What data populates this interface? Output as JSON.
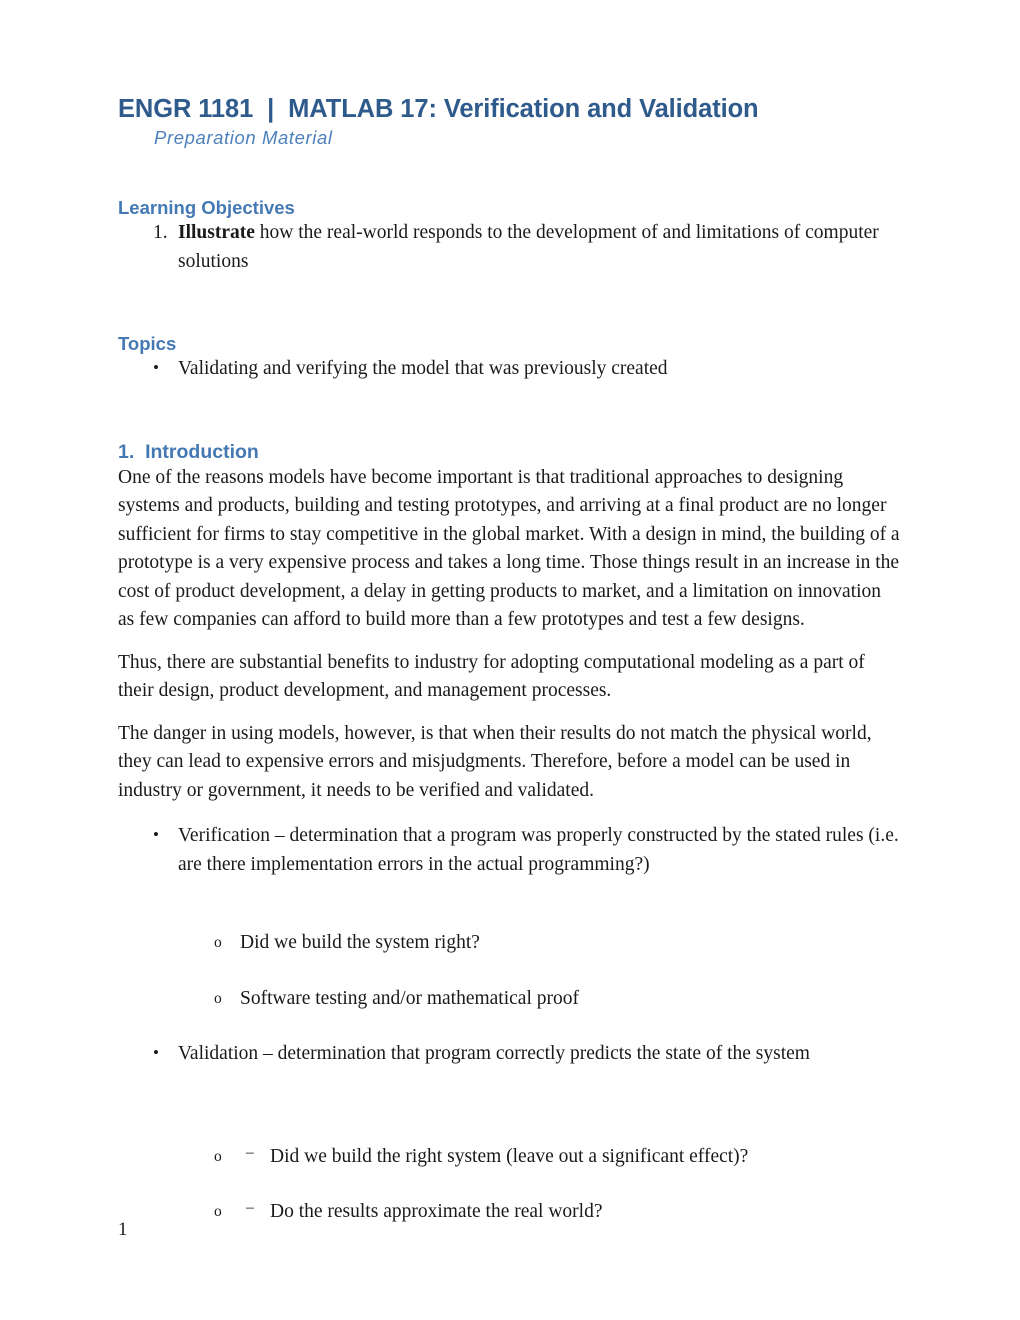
{
  "document": {
    "title": "ENGR 1181  |  MATLAB 17: Verification and Validation",
    "subtitle": "Preparation Material",
    "page_number": "1"
  },
  "colors": {
    "title_blue": "#2F5A8C",
    "heading_blue": "#4579B4",
    "subtitle_blue": "#4E80BC",
    "body_text": "#1a1a1a",
    "page_background": "#ffffff"
  },
  "sections": {
    "learning_objectives": {
      "heading": "Learning Objectives",
      "items": [
        {
          "marker": "1.",
          "lead": "Illustrate",
          "text": " how the real-world responds to the development of and limitations of computer solutions"
        }
      ]
    },
    "topics": {
      "heading": "Topics",
      "items": [
        {
          "marker": "•",
          "text": "Validating and verifying the model that was previously created"
        }
      ]
    },
    "introduction": {
      "heading": "1.  Introduction",
      "paragraphs": [
        "One of the reasons models have become important is that traditional approaches to designing systems and products, building and testing prototypes, and arriving at a final product are no longer sufficient for firms to stay competitive in the global market. With a design in mind, the building of a prototype is a very expensive process and takes a long time. Those things result in an increase in the cost of product development, a delay in getting products to market, and a limitation on innovation as few companies can afford to build more than a few prototypes and test a few designs.",
        "Thus, there are substantial benefits to industry for adopting computational modeling as a part of their design, product development, and management processes.",
        "The danger in using models, however, is that when their results do not match the physical world, they can lead to expensive errors and misjudgments. Therefore, before a model can be used in industry or government, it needs to be verified and validated."
      ],
      "verification": {
        "marker": "•",
        "text": "Verification – determination that a program was properly constructed by the stated rules (i.e. are there implementation errors in the actual programming?)",
        "sub_items": [
          {
            "marker": "o",
            "dash": "",
            "text": "Did we build the system right?"
          },
          {
            "marker": "o",
            "dash": "",
            "text": "Software testing and/or mathematical proof"
          }
        ]
      },
      "validation": {
        "marker": "•",
        "text": "Validation – determination that program correctly predicts the state of the system",
        "sub_items": [
          {
            "marker": "o",
            "dash": "–",
            "text": "Did we build the right system (leave out a significant effect)?"
          },
          {
            "marker": "o",
            "dash": "–",
            "text": "Do the results approximate the real world?"
          }
        ]
      }
    }
  }
}
